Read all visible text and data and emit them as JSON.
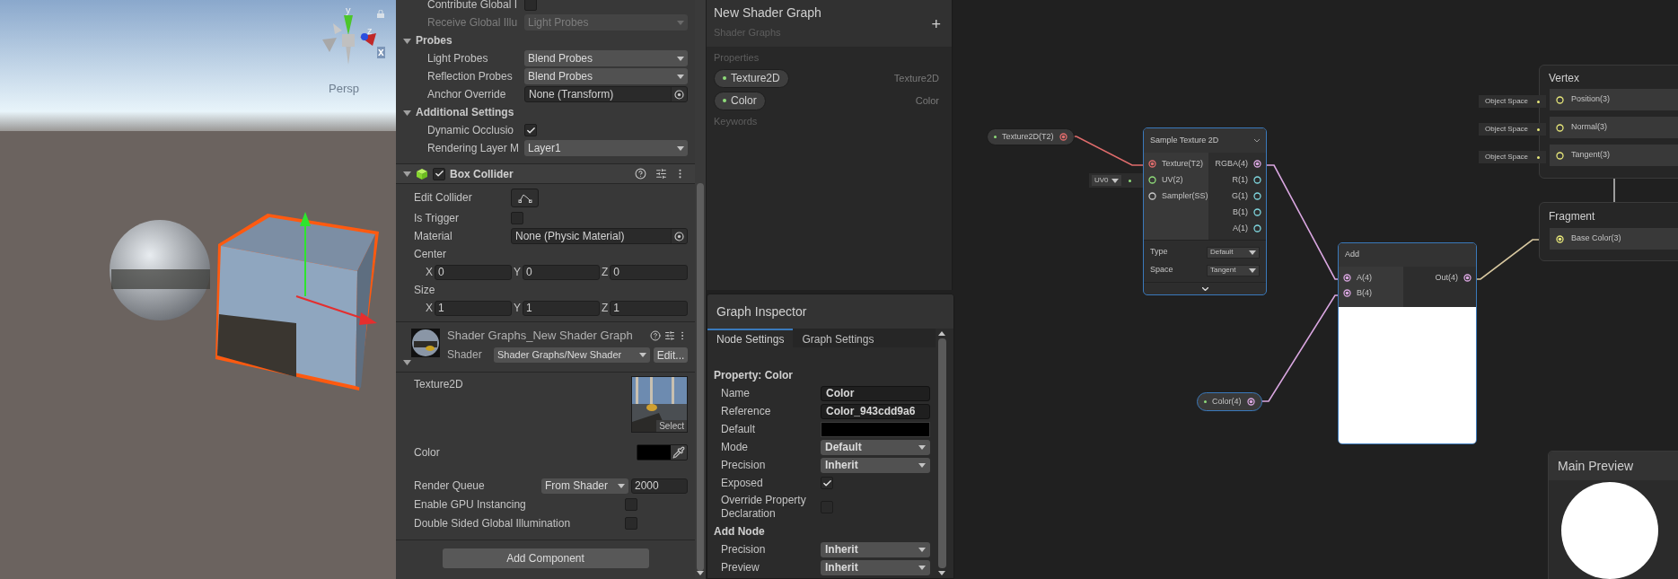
{
  "scene_view": {
    "gizmo_axes": [
      {
        "label": "y"
      },
      {
        "label": "z"
      },
      {
        "label": "x"
      }
    ],
    "projection": "Persp"
  },
  "inspector": {
    "items": [
      {
        "kind": "checkbox",
        "label": "Contribute Global I",
        "checked": false
      },
      {
        "kind": "dropdown",
        "label": "Receive Global Illu",
        "value": "Light Probes",
        "disabled": true
      },
      {
        "kind": "section",
        "label": "Probes",
        "expanded": true,
        "children": [
          {
            "kind": "dropdown",
            "label": "Light Probes",
            "value": "Blend Probes",
            "disabled": false
          },
          {
            "kind": "dropdown",
            "label": "Reflection Probes",
            "value": "Blend Probes",
            "disabled": false
          },
          {
            "kind": "object",
            "label": "Anchor Override",
            "value": "None (Transform)"
          }
        ]
      },
      {
        "kind": "section",
        "label": "Additional Settings",
        "expanded": true,
        "children": [
          {
            "kind": "checkbox",
            "label": "Dynamic Occlusio",
            "checked": true
          },
          {
            "kind": "dropdown",
            "label": "Rendering Layer M",
            "value": "Layer1",
            "disabled": false
          }
        ]
      }
    ],
    "box_collider": {
      "title": "Box Collider",
      "enabled": true,
      "expanded": true,
      "items": [
        {
          "kind": "button",
          "label": "Edit Collider"
        },
        {
          "kind": "checkbox",
          "label": "Is Trigger",
          "checked": false
        },
        {
          "kind": "object",
          "label": "Material",
          "value": "None (Physic Material)"
        },
        {
          "kind": "heading",
          "label": "Center"
        },
        {
          "kind": "vector",
          "fields": [
            {
              "axis": "X",
              "value": "0"
            },
            {
              "axis": "Y",
              "value": "0"
            },
            {
              "axis": "Z",
              "value": "0"
            }
          ]
        },
        {
          "kind": "heading",
          "label": "Size"
        },
        {
          "kind": "vector",
          "fields": [
            {
              "axis": "X",
              "value": "1"
            },
            {
              "axis": "Y",
              "value": "1"
            },
            {
              "axis": "Z",
              "value": "1"
            }
          ]
        }
      ]
    },
    "material": {
      "title": "Shader Graphs_New Shader Graph",
      "shader_label": "Shader",
      "shader": "Shader Graphs/New Shader",
      "edit": "Edit...",
      "expanded": true,
      "items": [
        {
          "kind": "texture",
          "label": "Texture2D",
          "action": "Select"
        },
        {
          "kind": "color",
          "label": "Color",
          "color": "#000000"
        },
        {
          "kind": "queue",
          "label": "Render Queue",
          "mode": "From Shader",
          "value": "2000"
        },
        {
          "kind": "checkbox",
          "label": "Enable GPU Instancing",
          "checked": false
        },
        {
          "kind": "checkbox",
          "label": "Double Sided Global Illumination",
          "checked": false
        }
      ]
    },
    "add_component": "Add Component"
  },
  "blackboard": {
    "title": "New Shader Graph",
    "subtitle": "Shader Graphs",
    "add_symbol": "+",
    "sections": [
      {
        "title": "Properties",
        "items": [
          {
            "name": "Texture2D",
            "type": "Texture2D"
          },
          {
            "name": "Color",
            "type": "Color"
          }
        ]
      },
      {
        "title": "Keywords"
      }
    ]
  },
  "graph_inspector": {
    "title": "Graph Inspector",
    "tabs": [
      {
        "label": "Node Settings",
        "selected": true
      },
      {
        "label": "Graph Settings",
        "selected": false
      }
    ],
    "sections": [
      {
        "title": "Property: Color",
        "fields": [
          {
            "kind": "text",
            "label": "Name",
            "value": "Color"
          },
          {
            "kind": "text",
            "label": "Reference",
            "value": "Color_943cdd9a6"
          },
          {
            "kind": "color",
            "label": "Default",
            "color": "#000000"
          },
          {
            "kind": "dropdown",
            "label": "Mode",
            "value": "Default"
          },
          {
            "kind": "dropdown",
            "label": "Precision",
            "value": "Inherit"
          },
          {
            "kind": "checkbox",
            "label": "Exposed",
            "checked": true
          },
          {
            "kind": "checkbox",
            "label": "Override Property Declaration",
            "checked": false
          }
        ]
      },
      {
        "title": "Add Node",
        "fields": [
          {
            "kind": "dropdown",
            "label": "Precision",
            "value": "Inherit"
          },
          {
            "kind": "dropdown",
            "label": "Preview",
            "value": "Inherit"
          }
        ]
      }
    ]
  },
  "graph": {
    "property_nodes": [
      {
        "label": "Texture2D(T2)",
        "color": "#e06c6c"
      },
      {
        "label": "Color(4)",
        "color": "#d9a6e0"
      }
    ],
    "sample_texture": {
      "title": "Sample Texture 2D",
      "uv_default": "UV0",
      "inputs": [
        {
          "label": "Texture(T2)",
          "color": "#e06c6c",
          "connected": true
        },
        {
          "label": "UV(2)",
          "color": "#8fdc7a",
          "connected": false
        },
        {
          "label": "Sampler(SS)",
          "color": "#c8c8c8",
          "connected": false
        }
      ],
      "outputs": [
        {
          "label": "RGBA(4)",
          "color": "#d9a6e0",
          "connected": true
        },
        {
          "label": "R(1)",
          "color": "#7fd6de",
          "connected": false
        },
        {
          "label": "G(1)",
          "color": "#7fd6de",
          "connected": false
        },
        {
          "label": "B(1)",
          "color": "#7fd6de",
          "connected": false
        },
        {
          "label": "A(1)",
          "color": "#7fd6de",
          "connected": false
        }
      ],
      "settings": [
        {
          "label": "Type",
          "value": "Default"
        },
        {
          "label": "Space",
          "value": "Tangent"
        }
      ]
    },
    "add_node": {
      "title": "Add",
      "inputs": [
        {
          "label": "A(4)",
          "color": "#d9a6e0",
          "connected": true
        },
        {
          "label": "B(4)",
          "color": "#d9a6e0",
          "connected": true
        }
      ],
      "outputs": [
        {
          "label": "Out(4)",
          "color": "#d9a6e0",
          "connected": true
        }
      ]
    },
    "vertex": {
      "title": "Vertex",
      "slots": [
        {
          "label": "Position(3)",
          "default": "Object Space",
          "connected": false
        },
        {
          "label": "Normal(3)",
          "default": "Object Space",
          "connected": false
        },
        {
          "label": "Tangent(3)",
          "default": "Object Space",
          "connected": false
        }
      ]
    },
    "fragment": {
      "title": "Fragment",
      "slots": [
        {
          "label": "Base Color(3)",
          "connected": true
        }
      ]
    },
    "main_preview": {
      "title": "Main Preview"
    }
  }
}
